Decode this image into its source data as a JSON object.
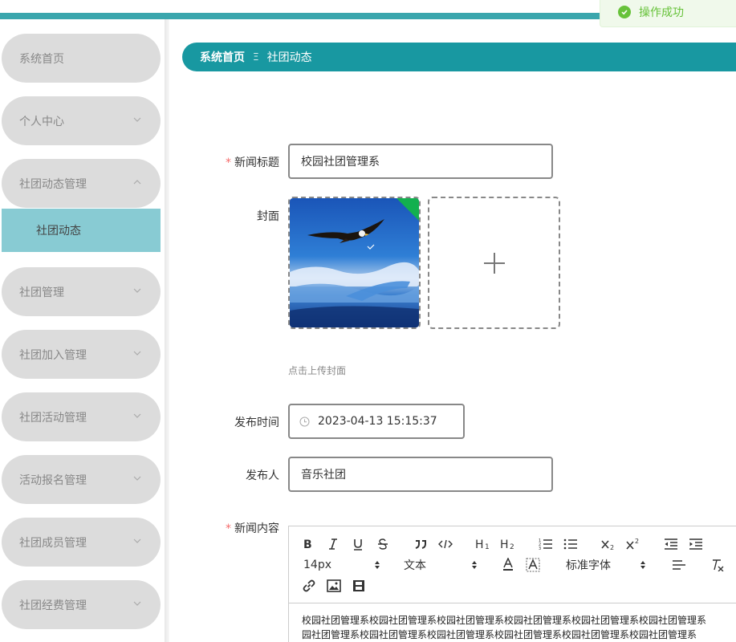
{
  "toast": {
    "message": "操作成功"
  },
  "sidebar": {
    "items": [
      {
        "label": "系统首页"
      },
      {
        "label": "个人中心"
      },
      {
        "label": "社团动态管理"
      },
      {
        "label": "社团管理"
      },
      {
        "label": "社团加入管理"
      },
      {
        "label": "社团活动管理"
      },
      {
        "label": "活动报名管理"
      },
      {
        "label": "社团成员管理"
      },
      {
        "label": "社团经费管理"
      }
    ],
    "sub_item": "社团动态"
  },
  "breadcrumb": {
    "home": "系统首页",
    "separator": "Ξ",
    "current": "社团动态"
  },
  "form": {
    "title_label": "新闻标题",
    "title_value": "校园社团管理系",
    "cover_label": "封面",
    "cover_hint": "点击上传封面",
    "time_label": "发布时间",
    "time_value": "2023-04-13 15:15:37",
    "publisher_label": "发布人",
    "publisher_value": "音乐社团",
    "content_label": "新闻内容",
    "required_mark": "*"
  },
  "editor": {
    "font_size": "14px",
    "block_type": "文本",
    "font_family": "标准字体",
    "content_line1": "校园社团管理系校园社团管理系校园社团管理系校园社团管理系校园社团管理系校园社团管理系",
    "content_line2": "园社团管理系校园社团管理系校园社团管理系校园社团管理系校园社团管理系校园社团管理系"
  },
  "colors": {
    "accent": "#1898a1",
    "stripe": "#3aa6ad",
    "success": "#67c23a",
    "required": "#f56c6c"
  }
}
